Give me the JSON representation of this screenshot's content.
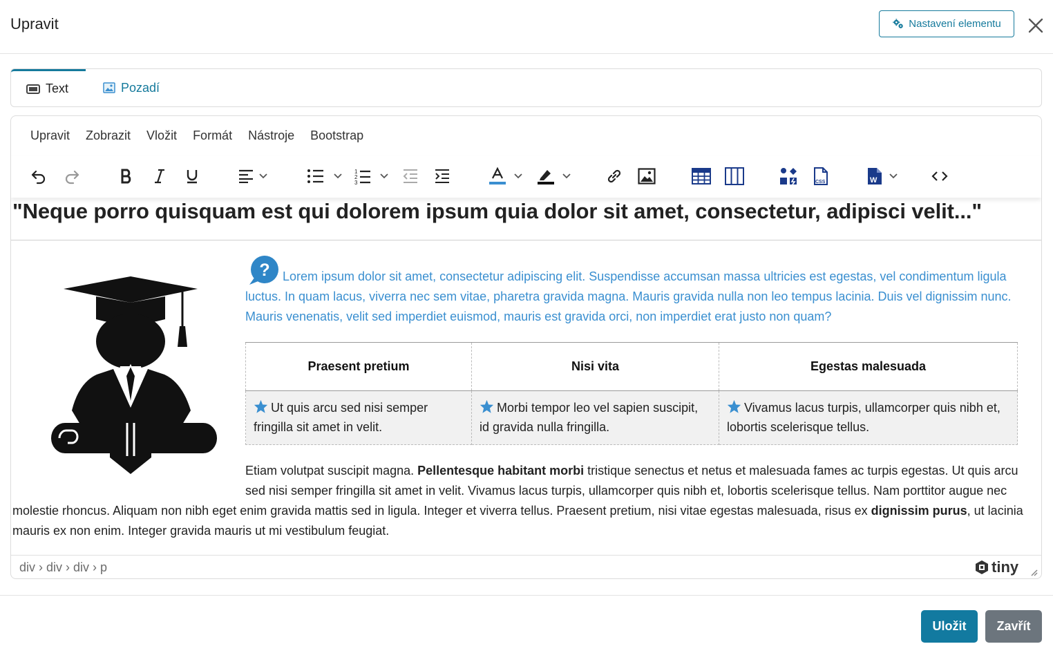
{
  "dialog": {
    "title": "Upravit",
    "settings_label": "Nastavení elementu",
    "save_label": "Uložit",
    "close_label": "Zavřít"
  },
  "tabs": [
    {
      "label": "Text",
      "icon": "text-box-icon"
    },
    {
      "label": "Pozadí",
      "icon": "image-icon"
    }
  ],
  "editor": {
    "menu": [
      "Upravit",
      "Zobrazit",
      "Vložit",
      "Formát",
      "Nástroje",
      "Bootstrap"
    ],
    "toolbar_icons": [
      "undo-icon",
      "redo-icon",
      "bold-icon",
      "italic-icon",
      "underline-icon",
      "align-left-icon",
      "bullet-list-icon",
      "numbered-list-icon",
      "outdent-icon",
      "indent-icon",
      "text-color-icon",
      "highlight-icon",
      "link-icon",
      "image-icon",
      "table-icon",
      "columns-icon",
      "icons-icon",
      "css-icon",
      "word-icon",
      "code-icon"
    ],
    "text_color_swatch": "#3a8fd0",
    "highlight_swatch": "#111111",
    "heading": "\"Neque porro quisquam est qui dolorem ipsum quia dolor sit amet, consectetur, adipisci velit...\"",
    "lead": "Lorem ipsum dolor sit amet, consectetur adipiscing elit. Suspendisse accumsan massa ultricies est egestas, vel condimentum ligula luctus. In quam lacus, viverra nec sem vitae, pharetra gravida magna. Mauris gravida nulla non leo tempus lacinia. Duis vel dignissim nunc. Mauris venenatis, velit sed imperdiet euismod, mauris est gravida orci, non imperdiet erat justo non quam?",
    "table": {
      "headers": [
        "Praesent pretium",
        "Nisi vita",
        "Egestas malesuada"
      ],
      "cells": [
        "Ut quis arcu sed nisi semper fringilla sit amet in velit.",
        "Morbi tempor leo vel sapien suscipit, id gravida nulla fringilla.",
        "Vivamus lacus turpis, ullamcorper quis nibh et, lobortis scelerisque tellus."
      ]
    },
    "body": {
      "part1": "Etiam volutpat suscipit magna. ",
      "bold1": "Pellentesque habitant morbi",
      "part2": " tristique senectus et netus et malesuada fames ac turpis egestas. Ut quis arcu sed nisi semper fringilla sit amet in velit. Vivamus lacus turpis, ullamcorper quis nibh et, lobortis scelerisque tellus. Nam porttitor augue nec molestie rhoncus. Aliquam non nibh eget enim gravida mattis sed in ligula. Integer et viverra tellus. Praesent pretium, nisi vitae egestas malesuada, risus ex ",
      "bold2": "dignissim purus",
      "part3": ", ut lacinia mauris ex non enim. Integer gravida mauris ut mi vestibulum feugiat."
    },
    "status_path": "div › div › div › p",
    "brand": "tiny",
    "accent_color": "#157a9c",
    "star_color": "#3a8fd0"
  }
}
